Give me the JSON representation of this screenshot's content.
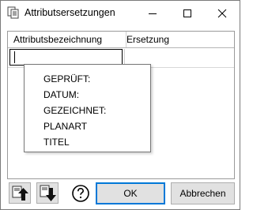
{
  "window": {
    "title": "Attributsersetzungen",
    "controls": {
      "minimize_icon": "minimize-icon",
      "maximize_icon": "maximize-icon",
      "close_icon": "close-icon"
    }
  },
  "grid": {
    "columns": [
      "Attributsbezeichnung",
      "Ersetzung"
    ],
    "rows": [
      {
        "attribute": "",
        "replacement": ""
      }
    ]
  },
  "dropdown": {
    "items": [
      "GEPRÜFT:",
      "DATUM:",
      "GEZEICHNET:",
      "PLANART",
      "TITEL"
    ]
  },
  "footer": {
    "move_up_icon": "arrow-up-icon",
    "move_down_icon": "arrow-down-icon",
    "help_icon": "question-circle-icon",
    "ok_label": "OK",
    "cancel_label": "Abbrechen"
  },
  "colors": {
    "accent": "#0078d7",
    "button_face": "#e1e1e1",
    "border": "#adadad"
  }
}
